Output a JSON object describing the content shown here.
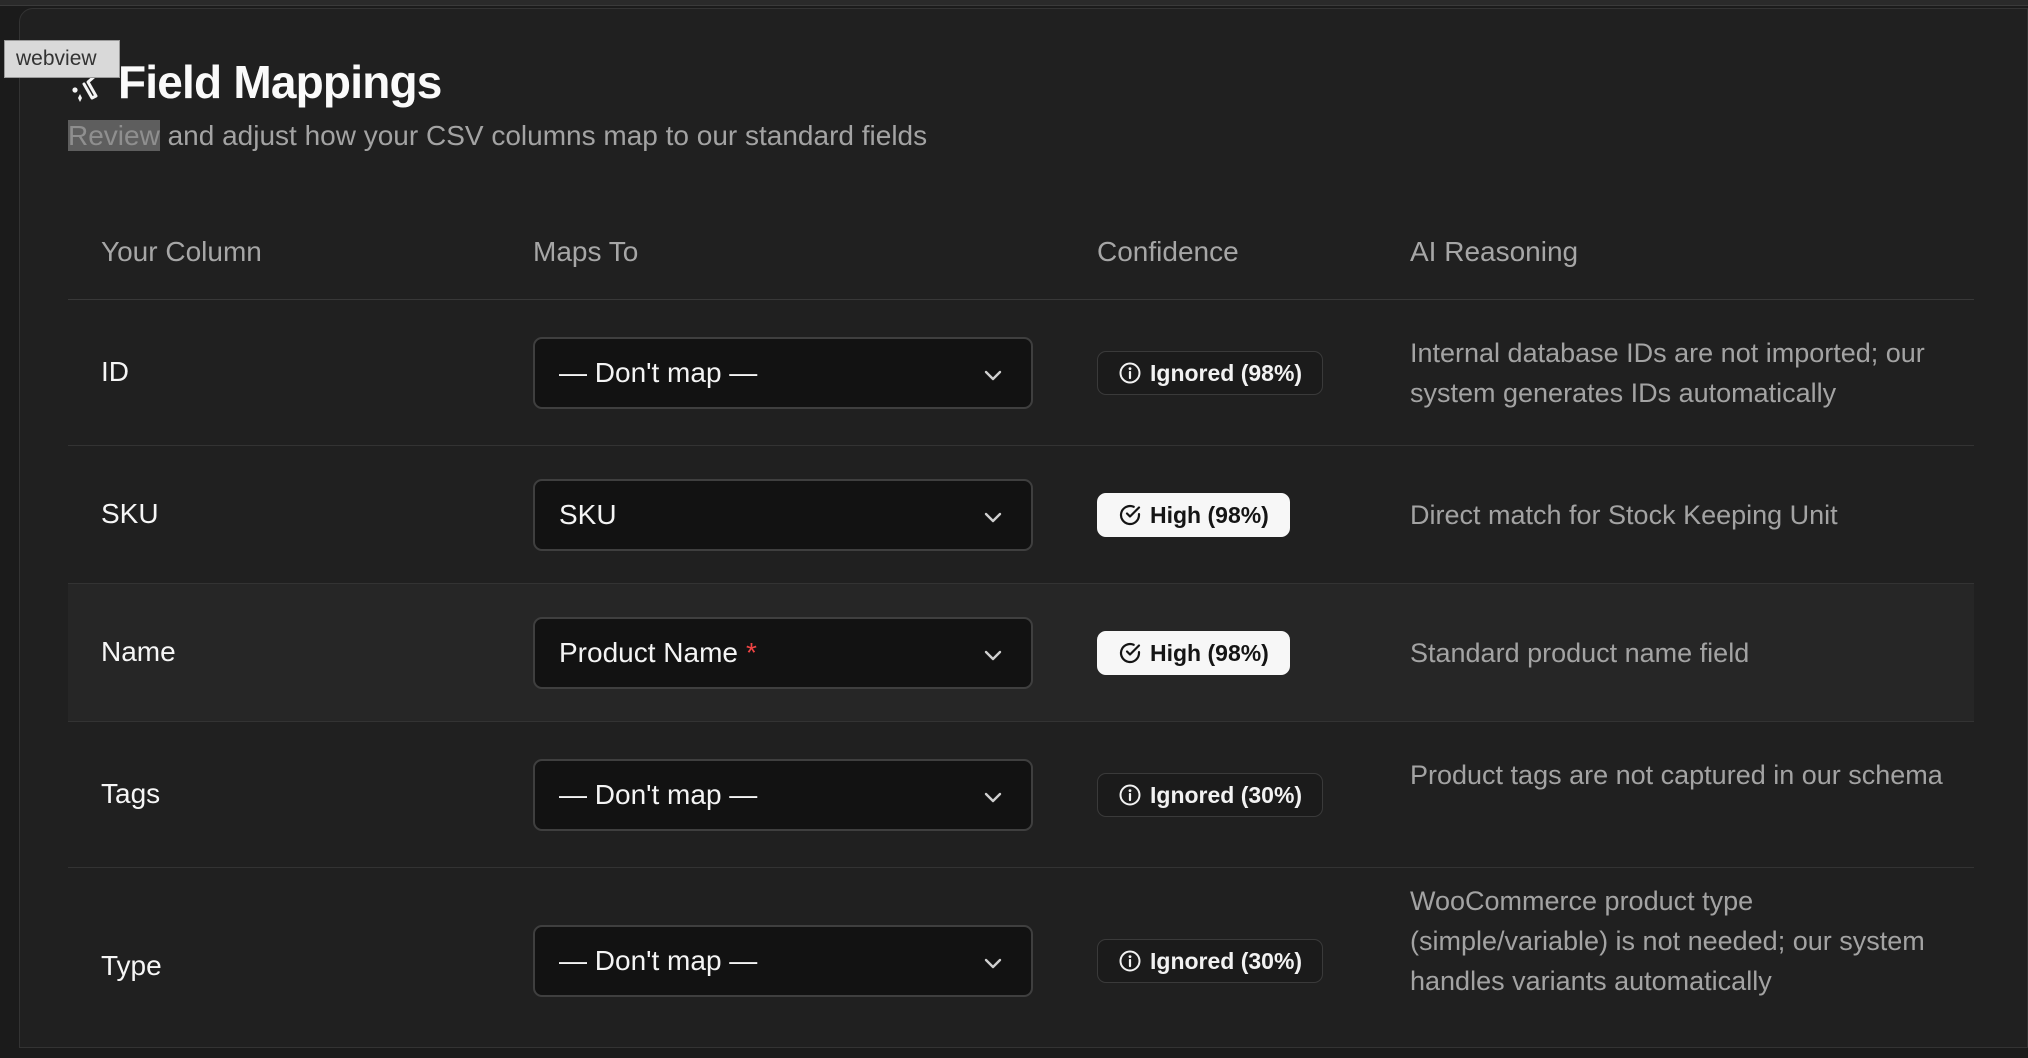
{
  "overlay": {
    "webview_label": "webview"
  },
  "header": {
    "title": "Field Mappings",
    "subtitle_selected": "Review",
    "subtitle_rest": " and adjust how your CSV columns map to our standard fields"
  },
  "table": {
    "columns": [
      "Your Column",
      "Maps To",
      "Confidence",
      "AI Reasoning"
    ],
    "rows": [
      {
        "column": "ID",
        "maps_to": "— Don't map —",
        "required": false,
        "confidence": "Ignored (98%)",
        "confidence_level": "ignored",
        "reasoning": "Internal database IDs are not imported; our system generates IDs automatically"
      },
      {
        "column": "SKU",
        "maps_to": "SKU",
        "required": false,
        "confidence": "High (98%)",
        "confidence_level": "high",
        "reasoning": "Direct match for Stock Keeping Unit"
      },
      {
        "column": "Name",
        "maps_to": "Product Name",
        "required": true,
        "required_marker": "*",
        "confidence": "High (98%)",
        "confidence_level": "high",
        "reasoning": "Standard product name field"
      },
      {
        "column": "Tags",
        "maps_to": "— Don't map —",
        "required": false,
        "confidence": "Ignored (30%)",
        "confidence_level": "ignored",
        "reasoning": "Product tags are not captured in our schema"
      },
      {
        "column": "Type",
        "maps_to": "— Don't map —",
        "required": false,
        "confidence": "Ignored (30%)",
        "confidence_level": "ignored",
        "reasoning": "WooCommerce product type (simple/variable) is not needed; our system handles variants automatically"
      }
    ]
  },
  "icons": {
    "title": "sparkle-wand-icon",
    "select_chevron": "chevron-down-icon",
    "ignored": "info-circle-icon",
    "high": "check-circle-icon"
  },
  "colors": {
    "background": "#202020",
    "select_background": "#121212",
    "high_badge": "#f7f7f7",
    "required_marker": "#ef4444",
    "muted_text": "#a3a3a3"
  }
}
